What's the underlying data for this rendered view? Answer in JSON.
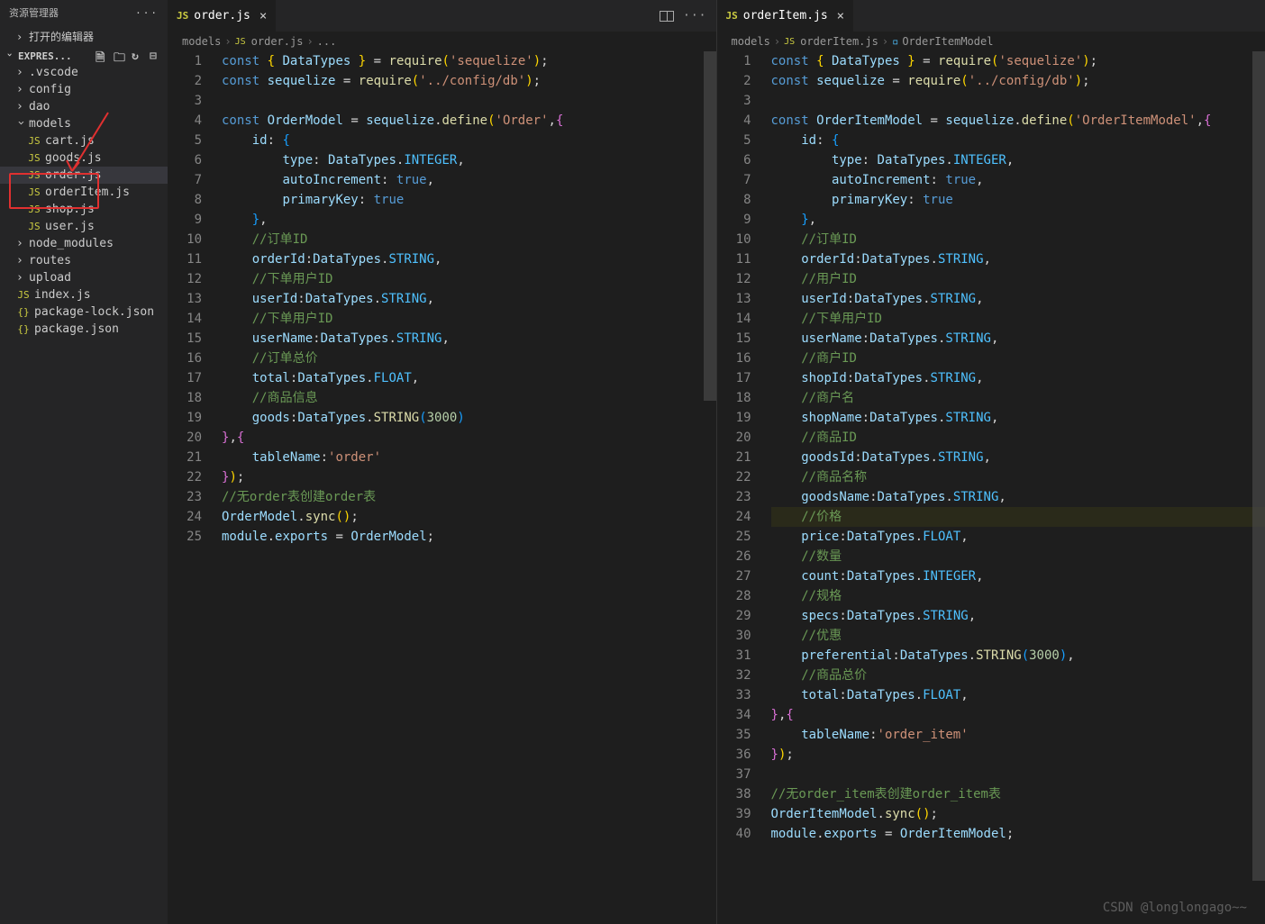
{
  "explorer": {
    "title": "资源管理器",
    "openEditors": "打开的编辑器",
    "project": "EXPRES...",
    "tree": [
      {
        "kind": "folder",
        "label": ".vscode",
        "open": false,
        "indent": 1
      },
      {
        "kind": "folder",
        "label": "config",
        "open": false,
        "indent": 1
      },
      {
        "kind": "folder",
        "label": "dao",
        "open": false,
        "indent": 1
      },
      {
        "kind": "folder",
        "label": "models",
        "open": true,
        "indent": 1
      },
      {
        "kind": "file",
        "label": "cart.js",
        "ico": "JS",
        "indent": 2
      },
      {
        "kind": "file",
        "label": "goods.js",
        "ico": "JS",
        "indent": 2
      },
      {
        "kind": "file",
        "label": "order.js",
        "ico": "JS",
        "indent": 2,
        "sel": true,
        "mark": true
      },
      {
        "kind": "file",
        "label": "orderItem.js",
        "ico": "JS",
        "indent": 2,
        "mark": true
      },
      {
        "kind": "file",
        "label": "shop.js",
        "ico": "JS",
        "indent": 2
      },
      {
        "kind": "file",
        "label": "user.js",
        "ico": "JS",
        "indent": 2
      },
      {
        "kind": "folder",
        "label": "node_modules",
        "open": false,
        "indent": 1
      },
      {
        "kind": "folder",
        "label": "routes",
        "open": false,
        "indent": 1
      },
      {
        "kind": "folder",
        "label": "upload",
        "open": false,
        "indent": 1
      },
      {
        "kind": "file",
        "label": "index.js",
        "ico": "JS",
        "indent": 1
      },
      {
        "kind": "file",
        "label": "package-lock.json",
        "ico": "{}",
        "indent": 1
      },
      {
        "kind": "file",
        "label": "package.json",
        "ico": "{}",
        "indent": 1
      }
    ]
  },
  "leftPane": {
    "tabLabel": "order.js",
    "breadcrumb": [
      "models",
      "order.js",
      "..."
    ],
    "lines": 25,
    "code": [
      "<span class='k'>const</span> <span class='br1'>{</span> <span class='v'>DataTypes</span> <span class='br1'>}</span> <span class='pn'>=</span> <span class='fn'>require</span><span class='br1'>(</span><span class='str'>'sequelize'</span><span class='br1'>)</span><span class='pn'>;</span>",
      "<span class='k'>const</span> <span class='v'>sequelize</span> <span class='pn'>=</span> <span class='fn'>require</span><span class='br1'>(</span><span class='str'>'../config/db'</span><span class='br1'>)</span><span class='pn'>;</span>",
      "",
      "<span class='k'>const</span> <span class='v'>OrderModel</span> <span class='pn'>=</span> <span class='v'>sequelize</span><span class='pn'>.</span><span class='fn'>define</span><span class='br1'>(</span><span class='str'>'Order'</span><span class='pn'>,</span><span class='br2'>{</span>",
      "    <span class='prop'>id</span><span class='pn'>:</span> <span class='br3'>{</span>",
      "        <span class='prop'>type</span><span class='pn'>:</span> <span class='v'>DataTypes</span><span class='pn'>.</span><span class='cnst'>INTEGER</span><span class='pn'>,</span>",
      "        <span class='prop'>autoIncrement</span><span class='pn'>:</span> <span class='k'>true</span><span class='pn'>,</span>",
      "        <span class='prop'>primaryKey</span><span class='pn'>:</span> <span class='k'>true</span>",
      "    <span class='br3'>}</span><span class='pn'>,</span>",
      "    <span class='cm'>//订单ID</span>",
      "    <span class='prop'>orderId</span><span class='pn'>:</span><span class='v'>DataTypes</span><span class='pn'>.</span><span class='cnst'>STRING</span><span class='pn'>,</span>",
      "    <span class='cm'>//下单用户ID</span>",
      "    <span class='prop'>userId</span><span class='pn'>:</span><span class='v'>DataTypes</span><span class='pn'>.</span><span class='cnst'>STRING</span><span class='pn'>,</span>",
      "    <span class='cm'>//下单用户ID</span>",
      "    <span class='prop'>userName</span><span class='pn'>:</span><span class='v'>DataTypes</span><span class='pn'>.</span><span class='cnst'>STRING</span><span class='pn'>,</span>",
      "    <span class='cm'>//订单总价</span>",
      "    <span class='prop'>total</span><span class='pn'>:</span><span class='v'>DataTypes</span><span class='pn'>.</span><span class='cnst'>FLOAT</span><span class='pn'>,</span>",
      "    <span class='cm'>//商品信息</span>",
      "    <span class='prop'>goods</span><span class='pn'>:</span><span class='v'>DataTypes</span><span class='pn'>.</span><span class='fn'>STRING</span><span class='br3'>(</span><span class='num'>3000</span><span class='br3'>)</span>",
      "<span class='br2'>}</span><span class='pn'>,</span><span class='br2'>{</span>",
      "    <span class='prop'>tableName</span><span class='pn'>:</span><span class='str'>'order'</span>",
      "<span class='br2'>}</span><span class='br1'>)</span><span class='pn'>;</span>",
      "<span class='cm'>//无order表创建order表</span>",
      "<span class='v'>OrderModel</span><span class='pn'>.</span><span class='fn'>sync</span><span class='br1'>()</span><span class='pn'>;</span>",
      "<span class='v'>module</span><span class='pn'>.</span><span class='v'>exports</span> <span class='pn'>=</span> <span class='v'>OrderModel</span><span class='pn'>;</span>"
    ]
  },
  "rightPane": {
    "tabLabel": "orderItem.js",
    "breadcrumb": [
      "models",
      "orderItem.js",
      "OrderItemModel"
    ],
    "lines": 40,
    "hlLine": 24,
    "code": [
      "<span class='k'>const</span> <span class='br1'>{</span> <span class='v'>DataTypes</span> <span class='br1'>}</span> <span class='pn'>=</span> <span class='fn'>require</span><span class='br1'>(</span><span class='str'>'sequelize'</span><span class='br1'>)</span><span class='pn'>;</span>",
      "<span class='k'>const</span> <span class='v'>sequelize</span> <span class='pn'>=</span> <span class='fn'>require</span><span class='br1'>(</span><span class='str'>'../config/db'</span><span class='br1'>)</span><span class='pn'>;</span>",
      "",
      "<span class='k'>const</span> <span class='v'>OrderItemModel</span> <span class='pn'>=</span> <span class='v'>sequelize</span><span class='pn'>.</span><span class='fn'>define</span><span class='br1'>(</span><span class='str'>'OrderItemModel'</span><span class='pn'>,</span><span class='br2'>{</span>",
      "    <span class='prop'>id</span><span class='pn'>:</span> <span class='br3'>{</span>",
      "        <span class='prop'>type</span><span class='pn'>:</span> <span class='v'>DataTypes</span><span class='pn'>.</span><span class='cnst'>INTEGER</span><span class='pn'>,</span>",
      "        <span class='prop'>autoIncrement</span><span class='pn'>:</span> <span class='k'>true</span><span class='pn'>,</span>",
      "        <span class='prop'>primaryKey</span><span class='pn'>:</span> <span class='k'>true</span>",
      "    <span class='br3'>}</span><span class='pn'>,</span>",
      "    <span class='cm'>//订单ID</span>",
      "    <span class='prop'>orderId</span><span class='pn'>:</span><span class='v'>DataTypes</span><span class='pn'>.</span><span class='cnst'>STRING</span><span class='pn'>,</span>",
      "    <span class='cm'>//用户ID</span>",
      "    <span class='prop'>userId</span><span class='pn'>:</span><span class='v'>DataTypes</span><span class='pn'>.</span><span class='cnst'>STRING</span><span class='pn'>,</span>",
      "    <span class='cm'>//下单用户ID</span>",
      "    <span class='prop'>userName</span><span class='pn'>:</span><span class='v'>DataTypes</span><span class='pn'>.</span><span class='cnst'>STRING</span><span class='pn'>,</span>",
      "    <span class='cm'>//商户ID</span>",
      "    <span class='prop'>shopId</span><span class='pn'>:</span><span class='v'>DataTypes</span><span class='pn'>.</span><span class='cnst'>STRING</span><span class='pn'>,</span>",
      "    <span class='cm'>//商户名</span>",
      "    <span class='prop'>shopName</span><span class='pn'>:</span><span class='v'>DataTypes</span><span class='pn'>.</span><span class='cnst'>STRING</span><span class='pn'>,</span>",
      "    <span class='cm'>//商品ID</span>",
      "    <span class='prop'>goodsId</span><span class='pn'>:</span><span class='v'>DataTypes</span><span class='pn'>.</span><span class='cnst'>STRING</span><span class='pn'>,</span>",
      "    <span class='cm'>//商品名称</span>",
      "    <span class='prop'>goodsName</span><span class='pn'>:</span><span class='v'>DataTypes</span><span class='pn'>.</span><span class='cnst'>STRING</span><span class='pn'>,</span>",
      "    <span class='cm'>//价格</span>",
      "    <span class='prop'>price</span><span class='pn'>:</span><span class='v'>DataTypes</span><span class='pn'>.</span><span class='cnst'>FLOAT</span><span class='pn'>,</span>",
      "    <span class='cm'>//数量</span>",
      "    <span class='prop'>count</span><span class='pn'>:</span><span class='v'>DataTypes</span><span class='pn'>.</span><span class='cnst'>INTEGER</span><span class='pn'>,</span>",
      "    <span class='cm'>//规格</span>",
      "    <span class='prop'>specs</span><span class='pn'>:</span><span class='v'>DataTypes</span><span class='pn'>.</span><span class='cnst'>STRING</span><span class='pn'>,</span>",
      "    <span class='cm'>//优惠</span>",
      "    <span class='prop'>preferential</span><span class='pn'>:</span><span class='v'>DataTypes</span><span class='pn'>.</span><span class='fn'>STRING</span><span class='br3'>(</span><span class='num'>3000</span><span class='br3'>)</span><span class='pn'>,</span>",
      "    <span class='cm'>//商品总价</span>",
      "    <span class='prop'>total</span><span class='pn'>:</span><span class='v'>DataTypes</span><span class='pn'>.</span><span class='cnst'>FLOAT</span><span class='pn'>,</span>",
      "<span class='br2'>}</span><span class='pn'>,</span><span class='br2'>{</span>",
      "    <span class='prop'>tableName</span><span class='pn'>:</span><span class='str'>'order_item'</span>",
      "<span class='br2'>}</span><span class='br1'>)</span><span class='pn'>;</span>",
      "",
      "<span class='cm'>//无order_item表创建order_item表</span>",
      "<span class='v'>OrderItemModel</span><span class='pn'>.</span><span class='fn'>sync</span><span class='br1'>()</span><span class='pn'>;</span>",
      "<span class='v'>module</span><span class='pn'>.</span><span class='v'>exports</span> <span class='pn'>=</span> <span class='v'>OrderItemModel</span><span class='pn'>;</span>"
    ]
  },
  "watermark": "CSDN @longlongago~~"
}
